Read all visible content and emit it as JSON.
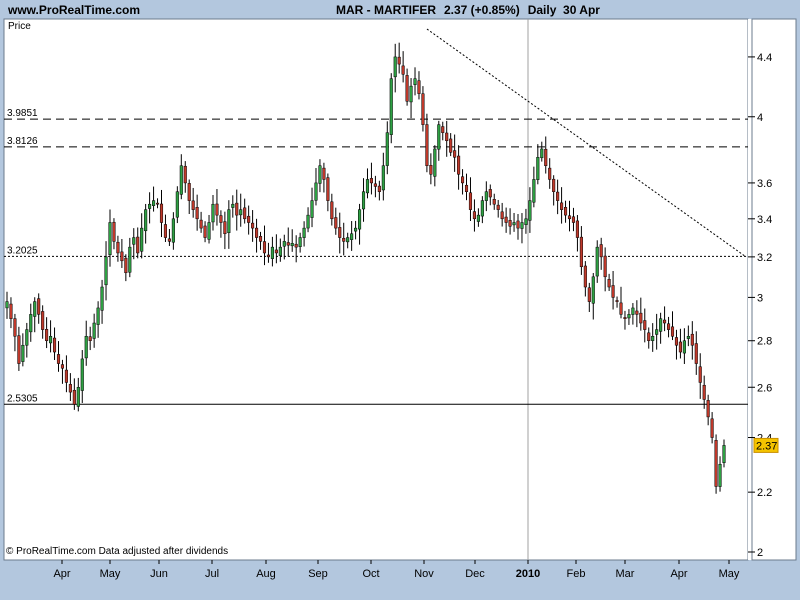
{
  "header": {
    "site": "www.ProRealTime.com",
    "ticker": "MAR - MARTIFER",
    "last": "2.37 (+0.85%)",
    "period": "Daily  30 Apr"
  },
  "footer": {
    "credit": "© ProRealTime.com  Data adjusted after dividends"
  },
  "chart_data": {
    "type": "candlestick",
    "ylabel": "Price",
    "scale": "log",
    "ylim": [
      2.0,
      4.6
    ],
    "yticks": [
      2,
      2.2,
      2.4,
      2.6,
      2.8,
      3,
      3.2,
      3.4,
      3.6,
      4,
      4.4
    ],
    "months": [
      "Apr",
      "May",
      "Jun",
      "Jul",
      "Aug",
      "Sep",
      "Oct",
      "Nov",
      "Dec",
      "2010",
      "Feb",
      "Mar",
      "Apr",
      "May"
    ],
    "hlines": [
      {
        "label": "3.9851",
        "value": 3.9851,
        "style": "dashed"
      },
      {
        "label": "3.8126",
        "value": 3.8126,
        "style": "dashed"
      },
      {
        "label": "3.2025",
        "value": 3.2025,
        "style": "dotted"
      },
      {
        "label": "2.5305",
        "value": 2.5305,
        "style": "solid"
      }
    ],
    "trendline": {
      "from": {
        "x_index": 53,
        "y": 4.6
      },
      "to": {
        "x_index": 279,
        "y": 3.2
      },
      "style": "dotted"
    },
    "last_price": "2.37",
    "closes": [
      2.98,
      2.9,
      2.82,
      2.7,
      2.78,
      2.85,
      2.92,
      2.98,
      2.92,
      2.85,
      2.8,
      2.82,
      2.75,
      2.7,
      2.68,
      2.62,
      2.58,
      2.53,
      2.6,
      2.72,
      2.82,
      2.8,
      2.88,
      2.95,
      3.05,
      3.2,
      3.38,
      3.28,
      3.22,
      3.18,
      3.12,
      3.25,
      3.3,
      3.22,
      3.35,
      3.45,
      3.48,
      3.5,
      3.48,
      3.38,
      3.3,
      3.28,
      3.4,
      3.55,
      3.7,
      3.6,
      3.5,
      3.45,
      3.4,
      3.35,
      3.3,
      3.38,
      3.48,
      3.42,
      3.38,
      3.32,
      3.45,
      3.48,
      3.42,
      3.45,
      3.4,
      3.38,
      3.35,
      3.3,
      3.28,
      3.22,
      3.2,
      3.25,
      3.22,
      3.25,
      3.28,
      3.26,
      3.27,
      3.25,
      3.3,
      3.35,
      3.42,
      3.5,
      3.6,
      3.7,
      3.62,
      3.5,
      3.4,
      3.35,
      3.3,
      3.28,
      3.3,
      3.32,
      3.35,
      3.45,
      3.55,
      3.62,
      3.6,
      3.58,
      3.55,
      3.7,
      3.9,
      4.25,
      4.4,
      4.35,
      4.28,
      4.1,
      4.2,
      4.25,
      4.15,
      3.95,
      3.7,
      3.65,
      3.8,
      3.95,
      3.9,
      3.85,
      3.78,
      3.75,
      3.65,
      3.6,
      3.55,
      3.45,
      3.4,
      3.42,
      3.5,
      3.55,
      3.52,
      3.48,
      3.45,
      3.4,
      3.38,
      3.36,
      3.38,
      3.35,
      3.38,
      3.4,
      3.5,
      3.62,
      3.75,
      3.8,
      3.7,
      3.62,
      3.55,
      3.5,
      3.45,
      3.42,
      3.4,
      3.38,
      3.3,
      3.15,
      3.05,
      2.98,
      3.1,
      3.25,
      3.2,
      3.1,
      3.05,
      3.0,
      2.98,
      2.92,
      2.9,
      2.92,
      2.95,
      2.92,
      2.88,
      2.85,
      2.8,
      2.82,
      2.85,
      2.9,
      2.88,
      2.85,
      2.82,
      2.78,
      2.75,
      2.8,
      2.82,
      2.78,
      2.7,
      2.62,
      2.55,
      2.48,
      2.4,
      2.22,
      2.3,
      2.37
    ]
  }
}
